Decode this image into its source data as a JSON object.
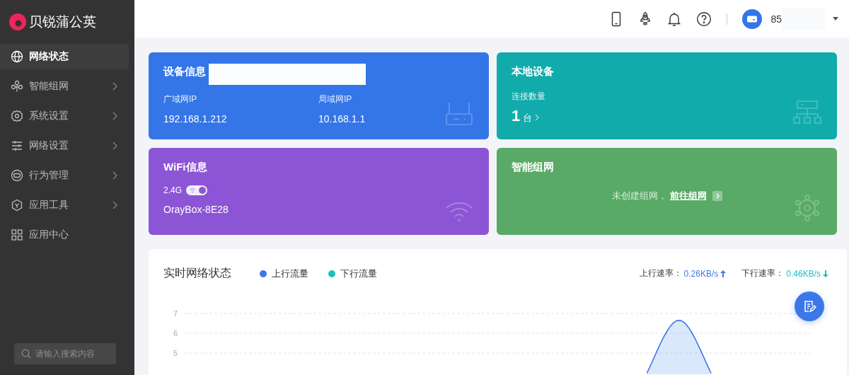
{
  "brand": {
    "name": "贝锐蒲公英"
  },
  "sidebar": {
    "items": [
      {
        "label": "网络状态",
        "selected": true,
        "has_submenu": false
      },
      {
        "label": "智能组网",
        "selected": false,
        "has_submenu": true
      },
      {
        "label": "系统设置",
        "selected": false,
        "has_submenu": true
      },
      {
        "label": "网络设置",
        "selected": false,
        "has_submenu": true
      },
      {
        "label": "行为管理",
        "selected": false,
        "has_submenu": true
      },
      {
        "label": "应用工具",
        "selected": false,
        "has_submenu": true
      },
      {
        "label": "应用中心",
        "selected": false,
        "has_submenu": false
      }
    ],
    "search": {
      "placeholder": "请输入搜索内容"
    }
  },
  "header": {
    "user": {
      "name": "85"
    }
  },
  "cards": [
    {
      "kind": "device",
      "title": "设备信息",
      "color": "#3476e8",
      "fields": [
        {
          "label": "广域网IP",
          "value": "192.168.1.212"
        },
        {
          "label": "局域网IP",
          "value": "10.168.1.1"
        }
      ]
    },
    {
      "kind": "local",
      "title": "本地设备",
      "color": "#12abab",
      "label": "连接数量",
      "count": "1",
      "unit": "台"
    },
    {
      "kind": "wifi",
      "title": "WiFi信息",
      "color": "#8c55d6",
      "band": "2.4G",
      "on": true,
      "ssid": "OrayBox-8E28"
    },
    {
      "kind": "mesh",
      "title": "智能组网",
      "color": "#59aa67",
      "message": "未创建组网，",
      "link": "前往组网"
    }
  ],
  "realtime": {
    "title": "实时网络状态",
    "legend": [
      {
        "label": "上行流量",
        "color": "#3a78ea"
      },
      {
        "label": "下行流量",
        "color": "#1cbfbf"
      }
    ],
    "rates": [
      {
        "label": "上行速率：",
        "value": "0.26KB/s",
        "color": "#3a78ea"
      },
      {
        "label": "下行速率：",
        "value": "0.46KB/s",
        "color": "#1cbfbf"
      }
    ],
    "axis_labels": [
      "7",
      "6",
      "5"
    ]
  }
}
